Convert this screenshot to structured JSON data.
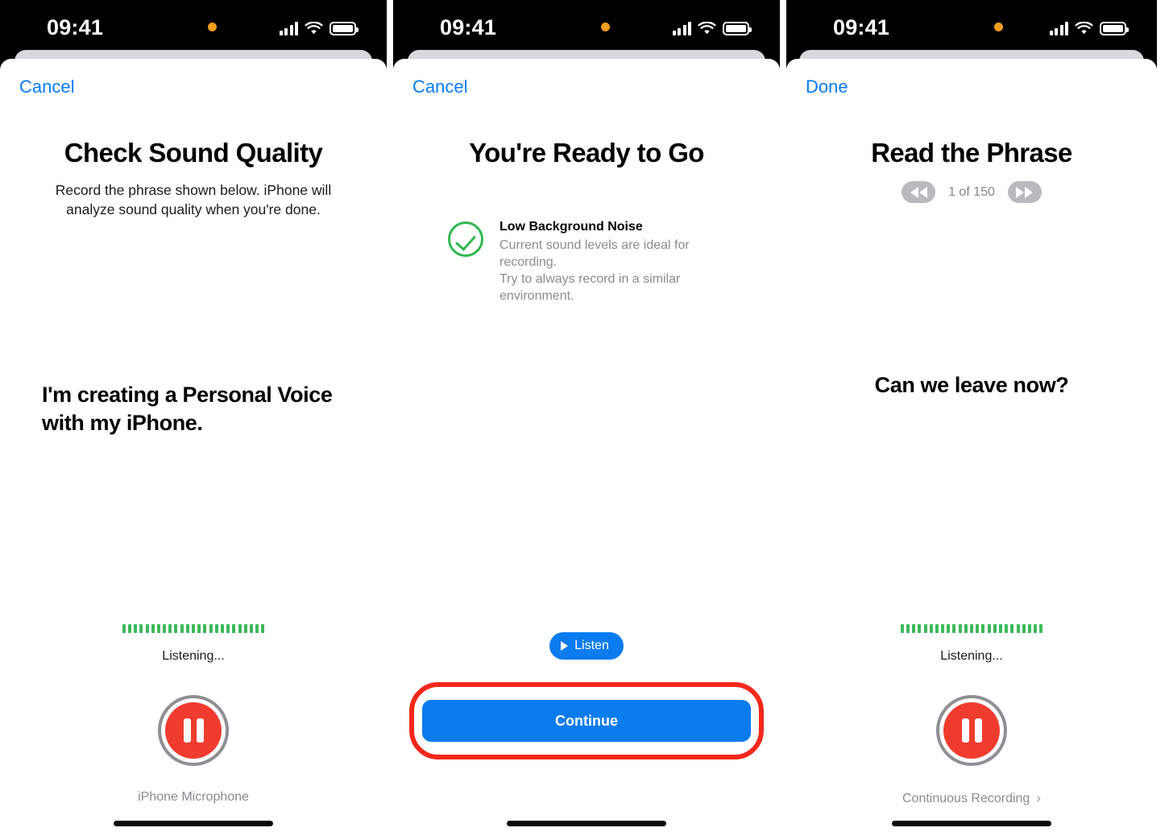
{
  "status_bar": {
    "time": "09:41",
    "icons": [
      "recording-indicator-dot",
      "cellular-signal-icon",
      "wifi-icon",
      "battery-icon"
    ]
  },
  "panels": [
    {
      "id": "check-sound-quality",
      "nav_button": "Cancel",
      "title": "Check Sound Quality",
      "subtitle": "Record the phrase shown below. iPhone will analyze sound quality when you're done.",
      "phrase": "I'm creating a Personal Voice with my iPhone.",
      "waveform_state": "active",
      "listening_label": "Listening...",
      "record_button_state": "recording-pause",
      "source_label": "iPhone Microphone"
    },
    {
      "id": "ready-to-go",
      "nav_button": "Cancel",
      "title": "You're Ready to Go",
      "status": {
        "icon": "green-check-icon",
        "title": "Low Background Noise",
        "line1": "Current sound levels are ideal for recording.",
        "line2": "Try to always record in a similar environment."
      },
      "listen_button": "Listen",
      "continue_button": "Continue",
      "highlight": "Continue"
    },
    {
      "id": "read-the-phrase",
      "nav_button": "Done",
      "title": "Read the Phrase",
      "pager": {
        "previous": "rewind-icon",
        "count": "1 of 150",
        "next": "fast-forward-icon"
      },
      "phrase": "Can we leave now?",
      "waveform_state": "active",
      "listening_label": "Listening...",
      "record_button_state": "recording-pause",
      "source_label": "Continuous Recording",
      "source_chevron": "›"
    }
  ],
  "colors": {
    "accent_blue": "#067bf5",
    "button_blue": "#0b7cf0",
    "record_red": "#f03c2e",
    "highlight_red": "#f4281c",
    "success_green": "#30b84f",
    "wave_green": "#3cb95a",
    "secondary_text": "#8b8b90",
    "recording_dot_orange": "#f29d1e"
  }
}
